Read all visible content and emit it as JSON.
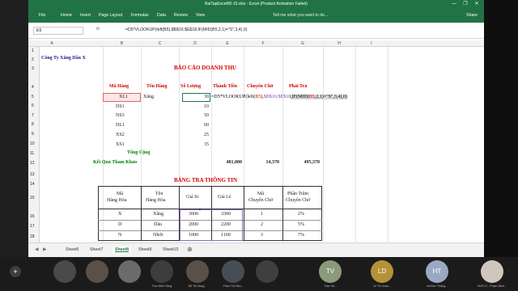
{
  "window": {
    "title": "BaiTapExcel06-10.xlsx - Excel (Product Activation Failed)",
    "min": "—",
    "max": "❐",
    "close": "✕"
  },
  "ribbon": {
    "tabs": [
      "File",
      "Home",
      "Insert",
      "Page Layout",
      "Formulas",
      "Data",
      "Review",
      "View"
    ],
    "active": "Home",
    "tellme": "Tell me what you want to do...",
    "share": "Share"
  },
  "formula_bar": {
    "name_box": "E5",
    "fx": "fx",
    "formula": "=D5*VLOOKUP(left(B5),$B$16:$E$18,IF(MID(B5,2,1)=\"S\",3,4),0)"
  },
  "columns": [
    "A",
    "B",
    "C",
    "D",
    "E",
    "F",
    "G",
    "H",
    "I"
  ],
  "rows": [
    "1",
    "2",
    "3",
    "4",
    "5",
    "6",
    "7",
    "8",
    "9",
    "10",
    "11",
    "12",
    "13",
    "14",
    "15",
    "16",
    "17",
    "18"
  ],
  "sheet": {
    "company": "Công Ty Xăng Dầu X",
    "report_title": "BÁO CÁO DOANH THU",
    "headers": [
      "Mã Hàng",
      "Tên Hàng",
      "Số Lượng",
      "Thành Tiền",
      "Chuyên Chở",
      "Phải Trả"
    ],
    "items": [
      {
        "code": "XL1",
        "name": "Xăng",
        "qty": "30"
      },
      {
        "code": "DS1",
        "name": "",
        "qty": "10"
      },
      {
        "code": "NS3",
        "name": "",
        "qty": "50"
      },
      {
        "code": "DL1",
        "name": "",
        "qty": "60"
      },
      {
        "code": "XS2",
        "name": "",
        "qty": "25"
      },
      {
        "code": "XS1",
        "name": "",
        "qty": "35"
      }
    ],
    "editing_formula": {
      "p1": "=D5*VLOOKUP(left(",
      "p2": "B5",
      "p3": "),",
      "p4": "$B$16:$E$18",
      "p5": ",IF(MID(",
      "p6": "B5",
      "p7": ",2,1)=\"S\",3,4),0)"
    },
    "total_label": "Tổng Cộng",
    "ref_label": "Kết Quả Tham Khảo",
    "ref_values": [
      "481,000",
      "14,370",
      "495,370"
    ],
    "lookup_title": "BẢNG TRA THÔNG TIN",
    "lookup_headers": [
      [
        "Mã",
        "Hàng Hóa"
      ],
      [
        "Tên",
        "Hàng Hóa"
      ],
      [
        "Giá Sỉ"
      ],
      [
        "Giá Lẻ"
      ],
      [
        "Mã",
        "Chuyên Chở"
      ],
      [
        "Phần Trăm",
        "Chuyên Chở"
      ]
    ],
    "lookup_rows": [
      [
        "X",
        "Xăng",
        "3000",
        "3300",
        "1",
        "2%"
      ],
      [
        "D",
        "Dầu",
        "2000",
        "2200",
        "2",
        "5%"
      ],
      [
        "N",
        "Nhớt",
        "1000",
        "1100",
        "3",
        "7%"
      ]
    ]
  },
  "sheet_tabs": [
    "Sheet6",
    "Sheet7",
    "Sheet8",
    "Sheet9",
    "Sheet10"
  ],
  "active_sheet": "Sheet8",
  "participants": [
    {
      "name": "Trần Minh Sang",
      "initials": "",
      "color": "#4a4a4a"
    },
    {
      "name": "Đỗ Thị Hùng...",
      "initials": "",
      "color": "#5a5048"
    },
    {
      "name": "Phan Thị Diệu...",
      "initials": "",
      "color": "#474d55"
    },
    {
      "name": "Trần Hà...",
      "initials": "TV",
      "color": "#8a9a7a"
    },
    {
      "name": "Lê Thị Xuân...",
      "initials": "LD",
      "color": "#b5913a"
    },
    {
      "name": "Hà Đức Thắng...",
      "initials": "HT",
      "color": "#9aa9c2"
    },
    {
      "name": "HUFLIT - Phạm Minh...",
      "initials": "",
      "color": "#cfc7bd"
    }
  ],
  "add_button": "+"
}
